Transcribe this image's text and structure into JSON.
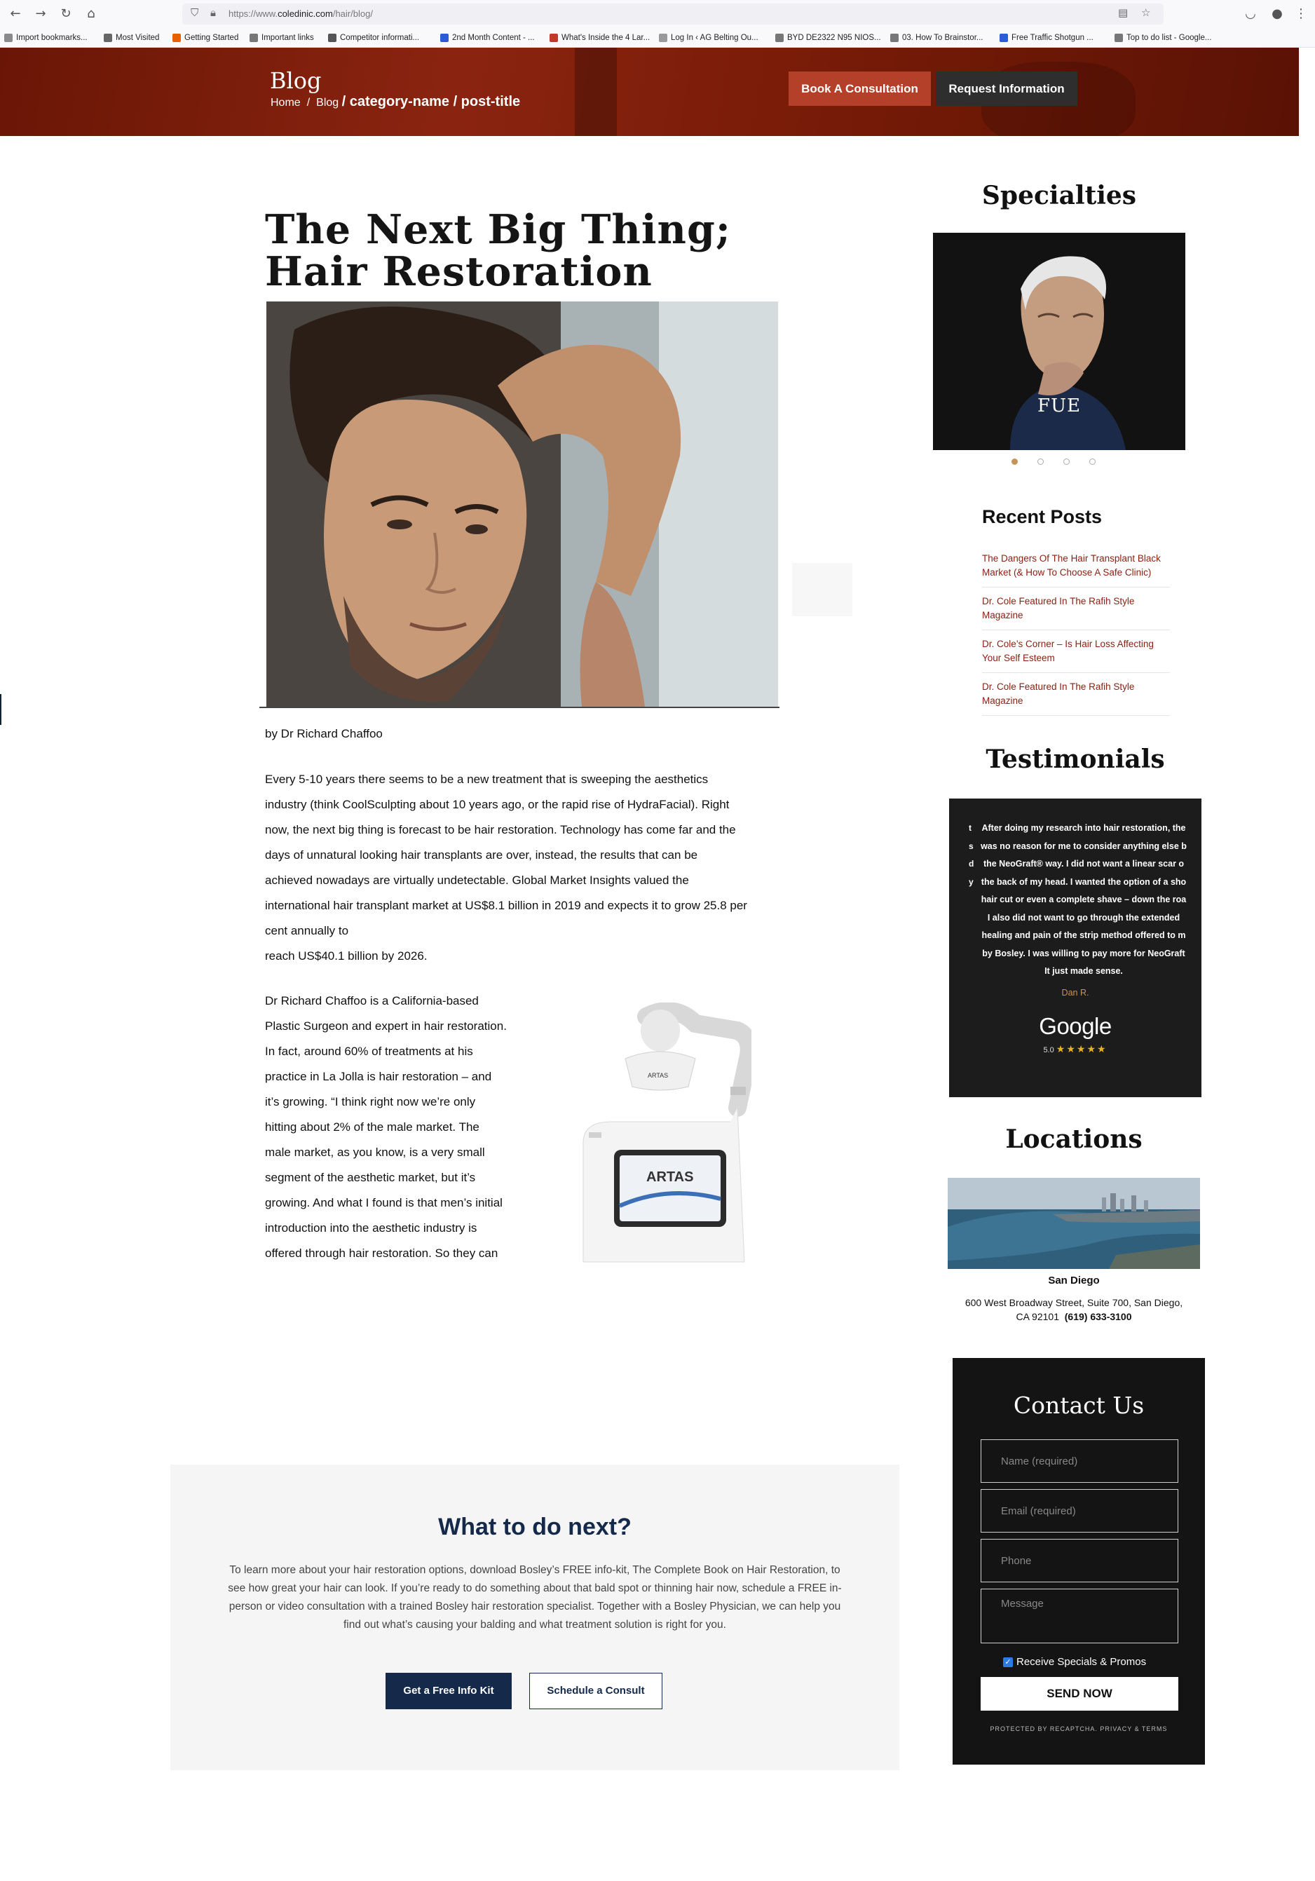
{
  "browser": {
    "url_prefix": "https://www.",
    "url_domain": "coledinic.com",
    "url_path": "/hair/blog/",
    "bookmarks": [
      "Import bookmarks...",
      "Most Visited",
      "Getting Started",
      "Important links",
      "Competitor informati...",
      "2nd Month Content - ...",
      "What's Inside the 4 Lar...",
      "Log In ‹ AG Belting Ou...",
      "BYD DE2322 N95 NIOS...",
      "03. How To Brainstor...",
      "Free Traffic Shotgun ...",
      "Top to do list - Google..."
    ]
  },
  "header": {
    "title": "Blog",
    "breadcrumb": {
      "home": "Home",
      "sep": "/",
      "blog": "Blog",
      "rest": "/ category-name / post-title"
    },
    "book_button": "Book A Consultation",
    "request_button": "Request Information"
  },
  "post": {
    "title": "The Next Big Thing; Hair Restoration",
    "byline": "by Dr Richard Chaffoo",
    "para1": [
      "Every 5-10 years there seems to be a new treatment that is sweeping the aesthetics",
      "industry (think CoolSculpting about 10 years ago, or the rapid rise of HydraFacial). Right",
      "now, the next big thing is forecast to be hair restoration. Technology has come far and the",
      "days of unnatural looking hair transplants are over, instead, the results that can be",
      "achieved nowadays are virtually undetectable. Global Market Insights valued the",
      "international hair transplant market at US$8.1 billion in 2019 and expects it to grow 25.8 per",
      "cent annually to",
      "reach US$40.1 billion by 2026."
    ],
    "para2": [
      "Dr Richard Chaffoo is a California-based",
      "Plastic Surgeon and expert in hair restoration.",
      "In fact, around 60% of treatments at his",
      "practice in La Jolla is hair restoration – and",
      "it’s growing. “I think right now we’re only",
      "hitting about 2% of the male market. The",
      "male market, as you know, is a very small",
      "segment of the aesthetic market, but it’s",
      "growing. And what I found is that men’s initial",
      "introduction into the aesthetic industry is",
      "offered through hair restoration. So they can"
    ],
    "device_label": "ARTAS"
  },
  "sidebar": {
    "specialties": {
      "heading": "Specialties",
      "slide_label": "FUE",
      "slide_count": 4,
      "active_slide": 1
    },
    "recent": {
      "heading": "Recent Posts",
      "items": [
        "The Dangers Of The Hair Transplant Black Market (& How To Choose A Safe Clinic)",
        "Dr. Cole Featured In The Rafih Style Magazine",
        "Dr. Cole’s Corner – Is Hair Loss Affecting Your Self Esteem",
        "Dr. Cole Featured In The Rafih Style Magazine"
      ]
    },
    "testimonials": {
      "heading": "Testimonials",
      "lines": [
        "After doing my research into hair restoration, the",
        "was no reason for me to consider anything else b",
        "the NeoGraft® way. I did not want a linear scar o",
        "the back of my head. I wanted the option of a sho",
        "hair cut or even a complete shave – down the roa",
        "I also did not want to go through the extended",
        "healing and pain of the strip method offered to m",
        "by Bosley. I was willing to pay more for NeoGraft",
        "It just made sense."
      ],
      "edge_letters": [
        "t",
        "s",
        "d",
        "y",
        "",
        "",
        "",
        "",
        ""
      ],
      "name": "Dan R.",
      "provider": "Google",
      "rating": "5.0",
      "stars": "★★★★★"
    },
    "locations": {
      "heading": "Locations",
      "city": "San Diego",
      "address": "600 West Broadway Street, Suite 700, San Diego,",
      "address2": "CA 92101",
      "phone": "(619) 633-3100"
    },
    "contact": {
      "heading": "Contact Us",
      "name_placeholder": "Name (required)",
      "email_placeholder": "Email (required)",
      "phone_placeholder": "Phone",
      "message_placeholder": "Message",
      "checkbox_label": "Receive Specials & Promos",
      "checkbox_checked": true,
      "send_label": "SEND NOW",
      "protected": "PROTECTED BY RECAPTCHA. PRIVACY & TERMS"
    }
  },
  "next": {
    "heading": "What to do next?",
    "text": "To learn more about your hair restoration options, download Bosley’s FREE info-kit, The Complete Book on Hair Restoration, to see how great your hair can look. If you’re ready to do something about that bald spot or thinning hair now, schedule a FREE in-person or video consultation with a trained Bosley hair restoration specialist. Together with a Bosley Physician, we can help you find out what’s causing your balding and what treatment solution is right for you.",
    "kit_button": "Get a Free Info Kit",
    "consult_button": "Schedule a Consult"
  },
  "colors": {
    "hero": "#7a1c08",
    "book_button": "#b5402a",
    "link": "#8a1f10",
    "navy": "#15294a",
    "gold": "#c8935a"
  }
}
